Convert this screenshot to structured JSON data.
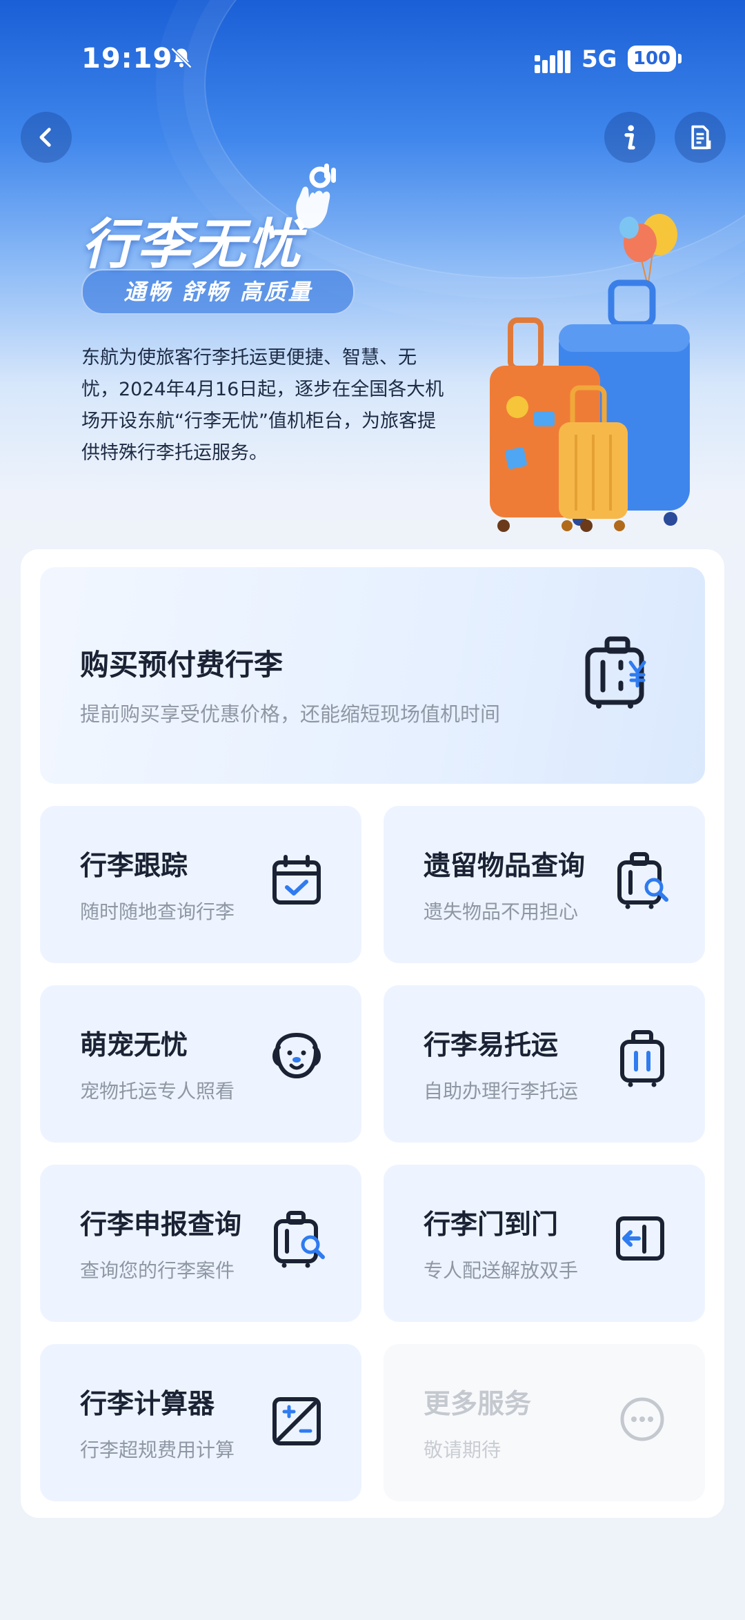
{
  "status_bar": {
    "time": "19:19",
    "network": "5G",
    "battery": "100"
  },
  "header": {
    "back_icon": "chevron-left-icon",
    "info_icon": "info-icon",
    "doc_icon": "document-icon"
  },
  "hero": {
    "title": "行李无忧",
    "tagline": "通畅 舒畅 高质量",
    "intro": "东航为使旅客行李托运更便捷、智慧、无忧，2024年4月16日起，逐步在全国各大机场开设东航“行李无忧”值机柜台，为旅客提供特殊行李托运服务。"
  },
  "services": {
    "featured": {
      "title": "购买预付费行李",
      "subtitle": "提前购买享受优惠价格，还能缩短现场值机时间",
      "icon": "luggage-yuan-icon"
    },
    "items": [
      {
        "title": "行李跟踪",
        "subtitle": "随时随地查询行李",
        "icon": "calendar-check-icon"
      },
      {
        "title": "遗留物品查询",
        "subtitle": "遗失物品不用担心",
        "icon": "luggage-search-icon"
      },
      {
        "title": "萌宠无忧",
        "subtitle": "宠物托运专人照看",
        "icon": "dog-icon"
      },
      {
        "title": "行李易托运",
        "subtitle": "自助办理行李托运",
        "icon": "suitcase-icon"
      },
      {
        "title": "行李申报查询",
        "subtitle": "查询您的行李案件",
        "icon": "luggage-search-icon"
      },
      {
        "title": "行李门到门",
        "subtitle": "专人配送解放双手",
        "icon": "door-arrow-icon"
      },
      {
        "title": "行李计算器",
        "subtitle": "行李超规费用计算",
        "icon": "calculator-icon"
      },
      {
        "title": "更多服务",
        "subtitle": "敬请期待",
        "icon": "more-dots-icon"
      }
    ]
  },
  "colors": {
    "primary": "#2a6ee0",
    "icon_dark": "#1b2233",
    "icon_accent": "#2f7bf0",
    "tile_bg": "#edf4ff"
  }
}
